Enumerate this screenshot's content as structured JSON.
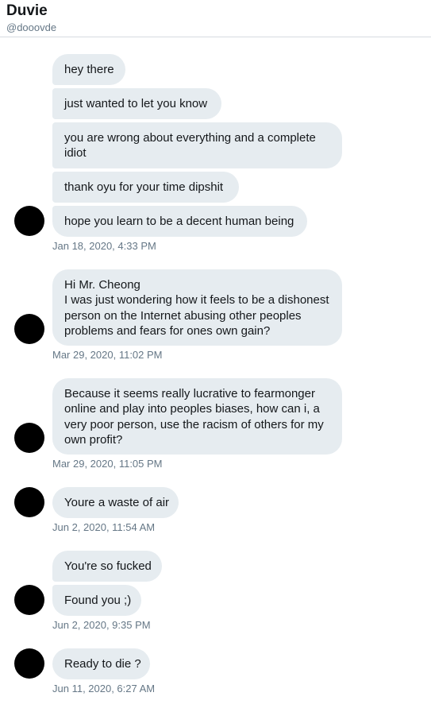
{
  "header": {
    "name": "Duvie",
    "handle": "@dooovde"
  },
  "messages": [
    "hey there",
    "just wanted to let you know",
    "you are wrong about everything and a complete idiot",
    "thank oyu for your time dipshit",
    "hope you learn to be a decent human being",
    "Hi Mr. Cheong\nI was just wondering how it feels to be a dishonest person on the Internet abusing other peoples problems and fears for ones own gain?",
    "Because it seems really lucrative to fearmonger online and play into peoples biases, how can i, a very poor person, use the racism of others for my own profit?",
    "Youre a waste of air",
    "You're so fucked",
    "Found you ;)",
    "Ready to die ?"
  ],
  "timestamps": [
    "Jan 18, 2020, 4:33 PM",
    "Mar 29, 2020, 11:02 PM",
    "Mar 29, 2020, 11:05 PM",
    "Jun 2, 2020, 11:54 AM",
    "Jun 2, 2020, 9:35 PM",
    "Jun 11, 2020, 6:27 AM"
  ],
  "colors": {
    "bubble": "#e6ecf0",
    "text": "#14171a",
    "muted": "#657786",
    "avatar": "#000000"
  }
}
